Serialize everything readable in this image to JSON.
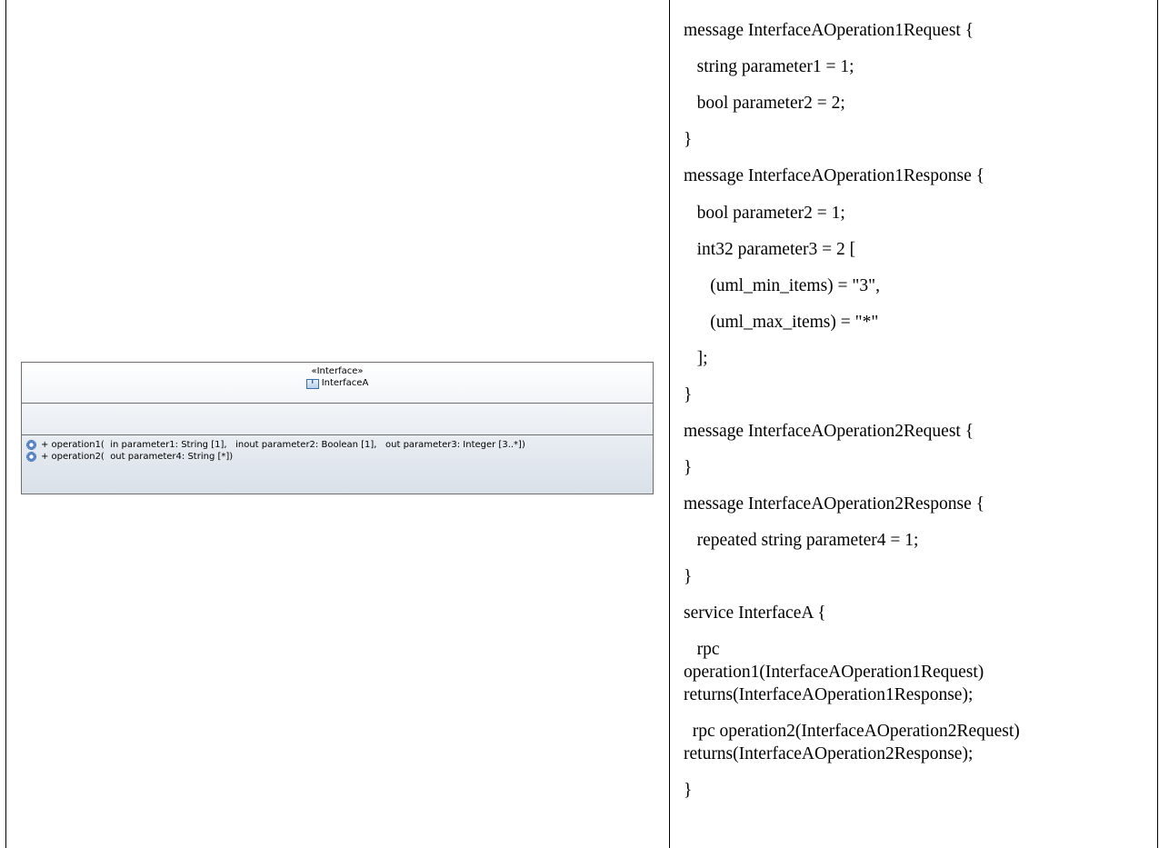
{
  "uml": {
    "stereotype": "«Interface»",
    "name": "InterfaceA",
    "operations": [
      "+ operation1(  in parameter1: String [1],   inout parameter2: Boolean [1],   out parameter3: Integer [3..*])",
      "+ operation2(  out parameter4: String [*])"
    ]
  },
  "code": [
    "message InterfaceAOperation1Request {",
    "   string parameter1 = 1;",
    "   bool parameter2 = 2;",
    "}",
    "message InterfaceAOperation1Response {",
    "   bool parameter2 = 1;",
    "   int32 parameter3 = 2 [",
    "      (uml_min_items) = \"3\",",
    "      (uml_max_items) = \"*\"",
    "   ];",
    "}",
    "message InterfaceAOperation2Request {",
    "}",
    "message InterfaceAOperation2Response {",
    "   repeated string parameter4 = 1;",
    "}",
    "service InterfaceA {",
    "   rpc",
    "operation1(InterfaceAOperation1Request)",
    "returns(InterfaceAOperation1Response);",
    "  rpc operation2(InterfaceAOperation2Request)",
    "returns(InterfaceAOperation2Response);",
    "}"
  ]
}
